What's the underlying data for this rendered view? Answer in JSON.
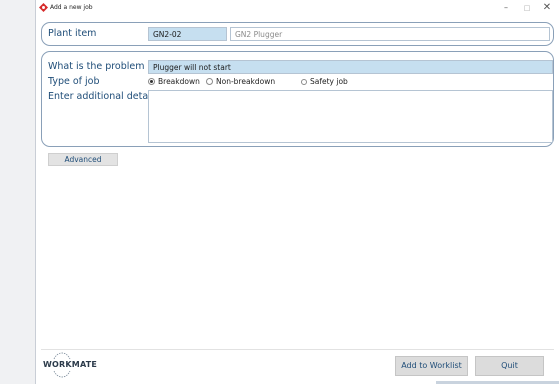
{
  "window": {
    "title": "Add a new job",
    "min_glyph": "–",
    "max_glyph": "□",
    "close_glyph": "✕"
  },
  "plant": {
    "label": "Plant item",
    "code": "GN2-02",
    "name": "GN2 Plugger"
  },
  "problem": {
    "label": "What is the problem",
    "value": "Plugger will not start"
  },
  "job_type": {
    "label": "Type of job",
    "options": [
      {
        "label": "Breakdown",
        "selected": true
      },
      {
        "label": "Non-breakdown",
        "selected": false
      },
      {
        "label": "Safety job",
        "selected": false
      }
    ]
  },
  "details": {
    "label": "Enter additional details",
    "value": ""
  },
  "advanced_label": "Advanced",
  "footer": {
    "logo_text": "WORKMATE",
    "add_label": "Add to Worklist",
    "quit_label": "Quit"
  },
  "colors": {
    "label_blue": "#1f4d78",
    "field_highlight": "#c6dff0",
    "panel_border": "#8aa0b8"
  },
  "icons": {
    "app": "red-diamond-icon",
    "logo": "workmate-gear-logo"
  }
}
